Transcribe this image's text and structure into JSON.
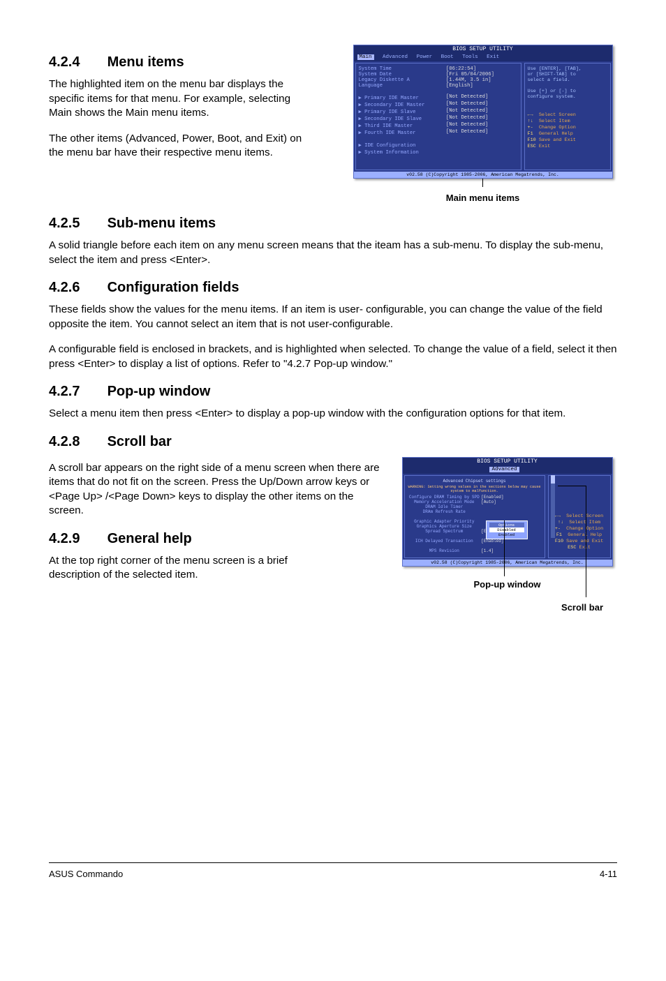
{
  "sections": {
    "s424": {
      "num": "4.2.4",
      "title": "Menu items",
      "p1": "The highlighted item on the menu bar displays the specific items for that menu. For example, selecting Main shows the Main menu items.",
      "p2": "The other items (Advanced, Power, Boot, and Exit) on the menu bar have their respective menu items."
    },
    "s425": {
      "num": "4.2.5",
      "title": "Sub-menu items",
      "p1": "A solid triangle before each item on any menu screen means that the iteam has a sub-menu. To display the sub-menu, select the item and press <Enter>."
    },
    "s426": {
      "num": "4.2.6",
      "title": "Configuration fields",
      "p1": "These fields show the values for the menu items. If an item is user- configurable, you can change the value of the field opposite the item. You cannot select an item that is not user-configurable.",
      "p2": "A configurable field is enclosed in brackets, and is highlighted when selected. To change the value of a field, select it then press <Enter> to display a list of options. Refer to \"4.2.7 Pop-up window.\""
    },
    "s427": {
      "num": "4.2.7",
      "title": "Pop-up window",
      "p1": "Select a menu item then press <Enter> to display a pop-up window with the configuration options for that item."
    },
    "s428": {
      "num": "4.2.8",
      "title": "Scroll bar",
      "p1": "A scroll bar appears on the right side of a menu screen when there are items that do not fit on the screen. Press the Up/Down arrow keys or <Page Up> /<Page Down> keys to display the other items on the screen."
    },
    "s429": {
      "num": "4.2.9",
      "title": "General help",
      "p1": "At the top right corner of the menu screen is a brief description of the selected item."
    }
  },
  "bios1": {
    "title": "BIOS SETUP UTILITY",
    "tabs": [
      "Main",
      "Advanced",
      "Power",
      "Boot",
      "Tools",
      "Exit"
    ],
    "rows": [
      {
        "lbl": "System Time",
        "val": "[06:22:54]"
      },
      {
        "lbl": "System Date",
        "val": "[Fri 05/04/2006]"
      },
      {
        "lbl": "Legacy Diskette A",
        "val": "[1.44M, 3.5 in]"
      },
      {
        "lbl": "Language",
        "val": "[English]"
      },
      {
        "lbl": "",
        "val": ""
      },
      {
        "lbl": "▶ Primary IDE Master",
        "val": "[Not Detected]"
      },
      {
        "lbl": "▶ Secondary IDE Master",
        "val": "[Not Detected]"
      },
      {
        "lbl": "▶ Primary IDE Slave",
        "val": "[Not Detected]"
      },
      {
        "lbl": "▶ Secondary IDE Slave",
        "val": "[Not Detected]"
      },
      {
        "lbl": "▶ Third IDE Master",
        "val": "[Not Detected]"
      },
      {
        "lbl": "▶ Fourth IDE Master",
        "val": "[Not Detected]"
      },
      {
        "lbl": "",
        "val": ""
      },
      {
        "lbl": "▶ IDE Configuration",
        "val": ""
      },
      {
        "lbl": "▶ System Information",
        "val": ""
      }
    ],
    "help": {
      "l1": "Use [ENTER], [TAB],",
      "l2": "or [SHIFT-TAB] to",
      "l3": "select a field.",
      "l4": "",
      "l5": "Use [+] or [-] to",
      "l6": "configure system."
    },
    "nav": [
      {
        "k": "←→",
        "d": "Select Screen"
      },
      {
        "k": "↑↓",
        "d": "Select Item"
      },
      {
        "k": "+-",
        "d": "Change Option"
      },
      {
        "k": "F1",
        "d": "General Help"
      },
      {
        "k": "F10",
        "d": "Save and Exit"
      },
      {
        "k": "ESC",
        "d": "Exit"
      }
    ],
    "footer": "v02.58 (C)Copyright 1985-2006, American Megatrends, Inc.",
    "caption": "Main menu items"
  },
  "bios2": {
    "title": "BIOS SETUP UTILITY",
    "tab": "Advanced",
    "heading": "Advanced Chipset settings",
    "warn": "WARNING: Setting wrong values in the sections below may cause system to malfunction.",
    "rows": [
      {
        "lbl": "Configure DRAM Timing by SPD",
        "val": "[Enabled]"
      },
      {
        "lbl": "Memory Acceleration Mode",
        "val": "[Auto]"
      },
      {
        "lbl": "DRAM Idle Timer",
        "val": ""
      },
      {
        "lbl": "DRAm Refresh Rate",
        "val": ""
      },
      {
        "lbl": "",
        "val": ""
      },
      {
        "lbl": "Graphic Adapter Priority",
        "val": ""
      },
      {
        "lbl": "Graphics Aperture Size",
        "val": ""
      },
      {
        "lbl": "Spread Spectrum",
        "val": "[Enabled]"
      },
      {
        "lbl": "",
        "val": ""
      },
      {
        "lbl": "ICH Delayed Transaction",
        "val": "[Enabled]"
      },
      {
        "lbl": "",
        "val": ""
      },
      {
        "lbl": "MPS Revision",
        "val": "[1.4]"
      }
    ],
    "popup": {
      "title": "Options",
      "o1": "Disabled",
      "o2": "Enabled"
    },
    "caption": "Pop-up window",
    "caption2": "Scroll bar"
  },
  "footer": {
    "left": "ASUS Commando",
    "right": "4-11"
  }
}
